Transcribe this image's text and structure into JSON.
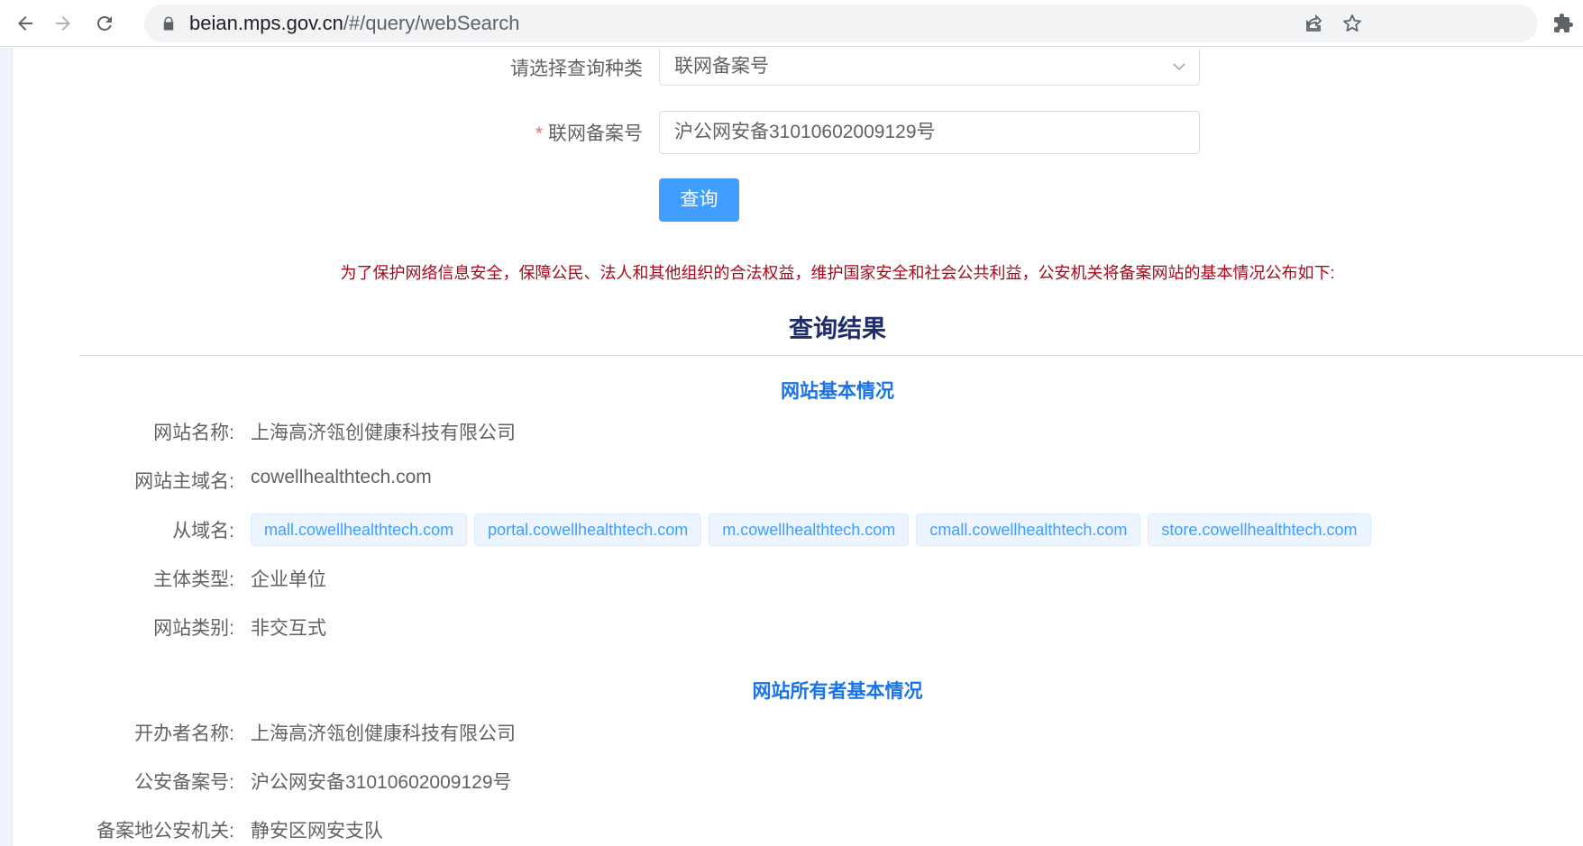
{
  "browser": {
    "url_host": "beian.mps.gov.cn",
    "url_path": "/#/query/webSearch",
    "icons": [
      "back-arrow-icon",
      "forward-arrow-icon",
      "reload-icon",
      "lock-icon",
      "share-icon",
      "bookmark-star-icon",
      "extensions-puzzle-icon"
    ]
  },
  "form": {
    "query_type_label": "请选择查询种类",
    "query_type_value": "联网备案号",
    "record_label": "联网备案号",
    "record_required_mark": "*",
    "record_value": "沪公网安备31010602009129号",
    "submit_label": "查询"
  },
  "notice": "为了保护网络信息安全，保障公民、法人和其他组织的合法权益，维护国家安全和社会公共利益，公安机关将备案网站的基本情况公布如下:",
  "result": {
    "title": "查询结果",
    "site_section": {
      "title": "网站基本情况",
      "site_name_label": "网站名称:",
      "site_name_value": "上海高济瓴创健康科技有限公司",
      "domain_label": "网站主域名:",
      "domain_value": "cowellhealthtech.com",
      "subdomains_label": "从域名:",
      "subdomains": [
        "mall.cowellhealthtech.com",
        "portal.cowellhealthtech.com",
        "m.cowellhealthtech.com",
        "cmall.cowellhealthtech.com",
        "store.cowellhealthtech.com"
      ],
      "entity_type_label": "主体类型:",
      "entity_type_value": "企业单位",
      "site_category_label": "网站类别:",
      "site_category_value": "非交互式"
    },
    "owner_section": {
      "title": "网站所有者基本情况",
      "organizer_label": "开办者名称:",
      "organizer_value": "上海高济瓴创健康科技有限公司",
      "police_record_label": "公安备案号:",
      "police_record_value": "沪公网安备31010602009129号",
      "police_office_label": "备案地公安机关:",
      "police_office_value": "静安区网安支队"
    }
  },
  "colors": {
    "accent": "#409eff",
    "notice": "#a8071a",
    "result_title": "#1f2d6b",
    "section_title": "#1a73e8"
  }
}
